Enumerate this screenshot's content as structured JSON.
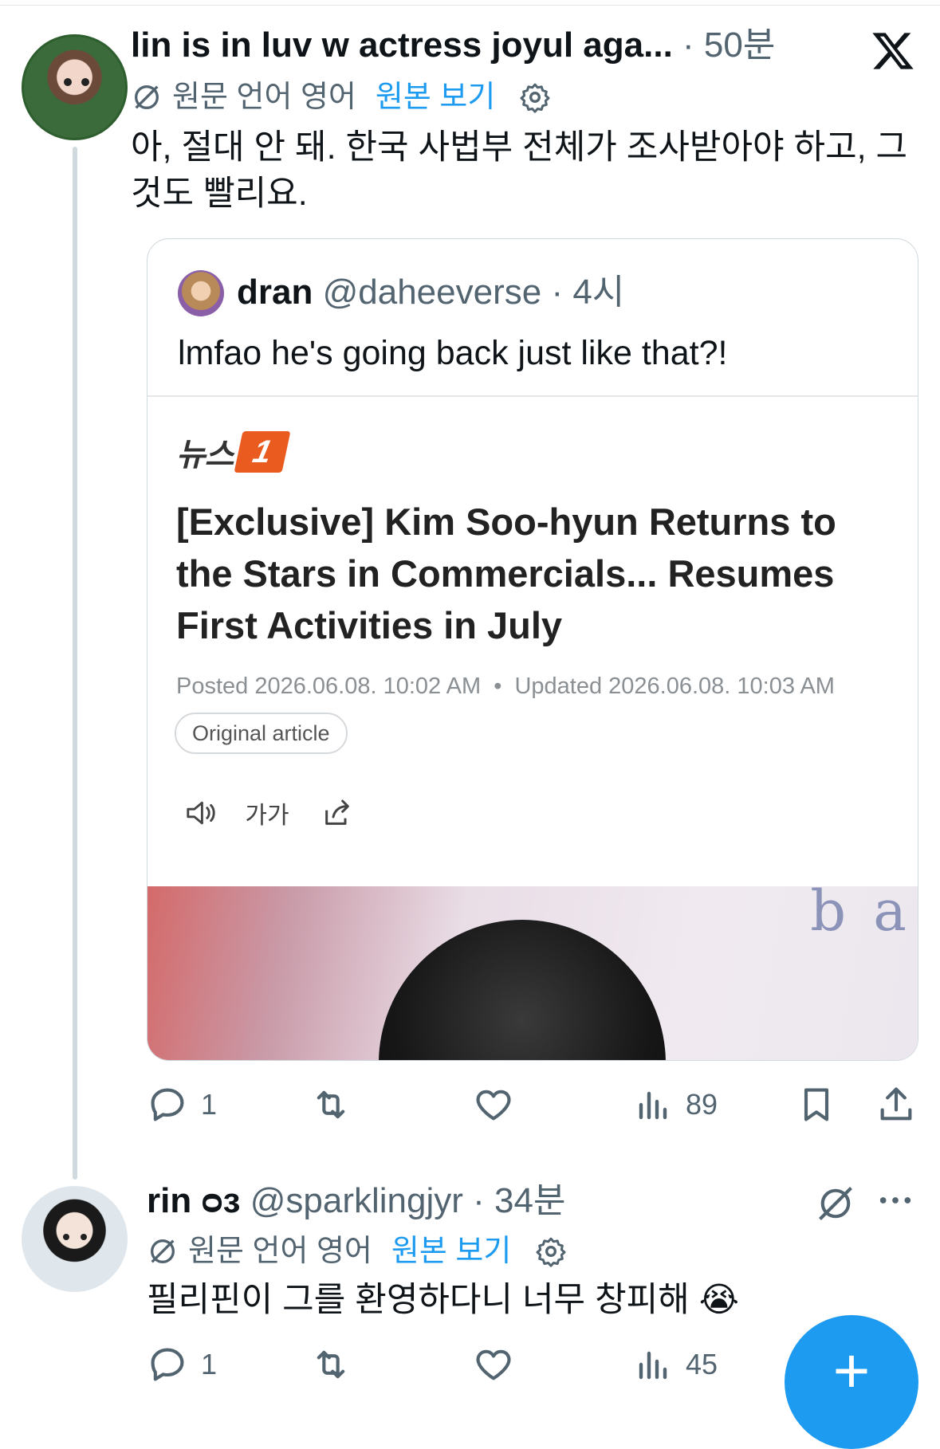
{
  "tweet1": {
    "display_name": "lin is in luv w actress joyul aga...",
    "time": "· 50분",
    "translate": {
      "label": "원문 언어 영어",
      "link": "원본 보기"
    },
    "text": "아, 절대 안 돼. 한국 사법부 전체가 조사받아야 하고, 그것도 빨리요.",
    "quoted": {
      "display_name": "dran",
      "handle": "@daheeverse",
      "time": "· 4시",
      "text": "lmfao he's going back just like that?!",
      "article": {
        "source_logo_text": "뉴스",
        "source_logo_badge": "1",
        "headline": "[Exclusive] Kim Soo-hyun Returns to the Stars in Commercials... Resumes First Activities in July",
        "posted_label": "Posted",
        "posted_value": "2026.06.08. 10:02 AM",
        "updated_label": "Updated",
        "updated_value": "2026.06.08. 10:03 AM",
        "original_article_label": "Original article",
        "font_size_tool_label": "가가",
        "photo_text": "b a"
      }
    },
    "actions": {
      "replies": "1",
      "retweets": "",
      "likes": "",
      "views": "89"
    }
  },
  "tweet2": {
    "display_name": "rin ᴑᴈ",
    "handle": "@sparklingjyr",
    "time": "· 34분",
    "translate": {
      "label": "원문 언어 영어",
      "link": "원본 보기"
    },
    "text": "필리핀이 그를 환영하다니 너무 창피해 😭",
    "actions": {
      "replies": "1",
      "retweets": "",
      "likes": "",
      "views": "45"
    }
  },
  "fab": {
    "label": "+"
  },
  "colors": {
    "accent": "#1d9bf0",
    "muted": "#536471",
    "news_orange": "#ea5b1f"
  },
  "icons": [
    "x-logo-icon",
    "translate-icon",
    "gear-icon",
    "reply-icon",
    "retweet-icon",
    "like-icon",
    "views-icon",
    "bookmark-icon",
    "share-icon",
    "speaker-icon",
    "font-size-icon",
    "share-article-icon",
    "grok-icon",
    "more-icon",
    "plus-icon"
  ]
}
